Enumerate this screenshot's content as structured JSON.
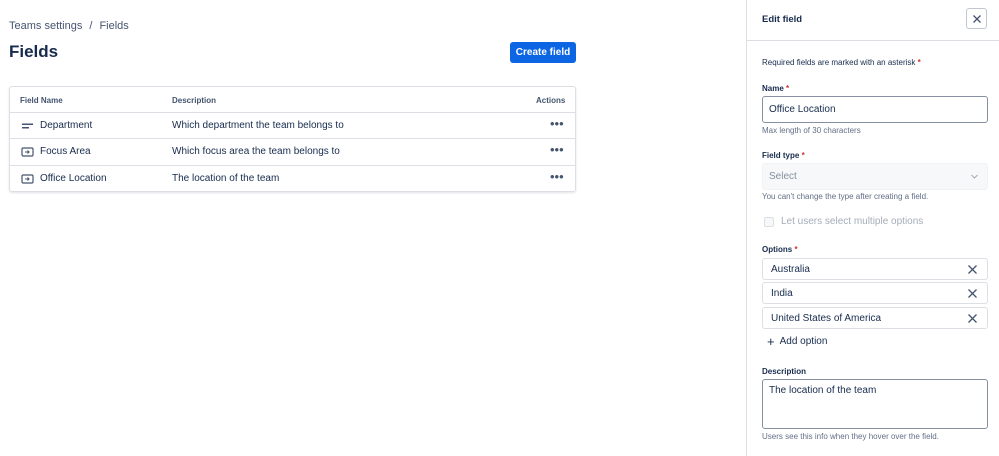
{
  "breadcrumb": {
    "parent": "Teams settings",
    "separator": "/",
    "current": "Fields"
  },
  "page": {
    "title": "Fields",
    "create_button": "Create field"
  },
  "table": {
    "headers": {
      "name": "Field Name",
      "description": "Description",
      "actions": "Actions"
    },
    "rows": [
      {
        "icon": "text-field-icon",
        "name": "Department",
        "description": "Which department the team belongs to",
        "actions": "•••"
      },
      {
        "icon": "select-field-icon",
        "name": "Focus Area",
        "description": "Which focus area the team belongs to",
        "actions": "•••"
      },
      {
        "icon": "select-field-icon",
        "name": "Office Location",
        "description": "The location of the team",
        "actions": "•••"
      }
    ]
  },
  "panel": {
    "title": "Edit field",
    "required_note": "Required fields are marked with an asterisk",
    "asterisk": "*",
    "name": {
      "label": "Name",
      "value": "Office Location",
      "helper": "Max length of 30 characters"
    },
    "field_type": {
      "label": "Field type",
      "placeholder": "Select",
      "helper": "You can't change the type after creating a field."
    },
    "multi_select": {
      "label": "Let users select multiple options",
      "checked": false,
      "disabled": true
    },
    "options": {
      "label": "Options",
      "items": [
        "Australia",
        "India",
        "United States of America"
      ],
      "add_label": "Add option"
    },
    "description": {
      "label": "Description",
      "value": "The location of the team",
      "helper": "Users see this info when they hover over the field."
    }
  },
  "colors": {
    "primary": "#0c66e4",
    "required": "#c9372c",
    "text": "#172b4d",
    "subtle": "#626f86",
    "border": "#dcdfe4"
  }
}
